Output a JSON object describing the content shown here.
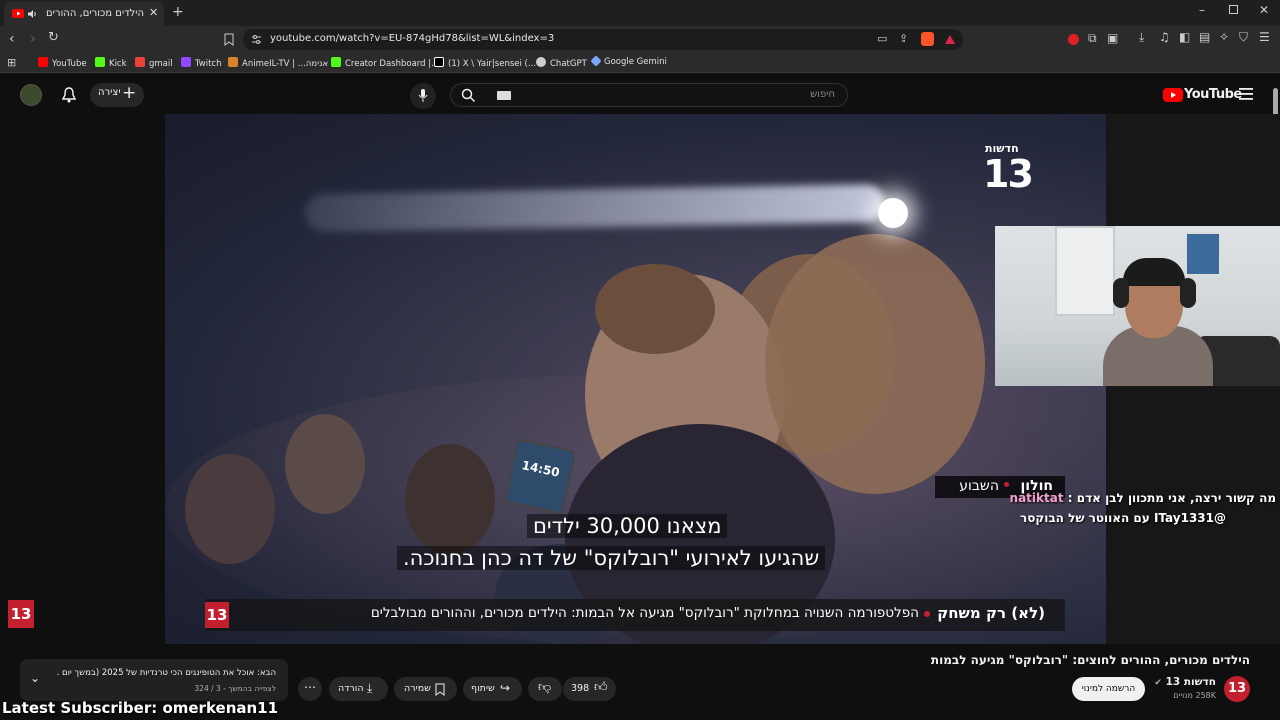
{
  "browser": {
    "tab_title": "הילדים מכורים, ההורים לחוצים",
    "url": "youtube.com/watch?v=EU-874gHd78&list=WL&index=3",
    "bookmarks": [
      {
        "label": "YouTube",
        "color": "#ff0000"
      },
      {
        "label": "Kick",
        "color": "#53fc18"
      },
      {
        "label": "gmail",
        "color": "#ea4335"
      },
      {
        "label": "Twitch",
        "color": "#9146ff"
      },
      {
        "label": "AnimeIL-TV | ...אנימה",
        "color": "#d9822b"
      },
      {
        "label": "Creator Dashboard |...",
        "color": "#53fc18"
      },
      {
        "label": "(1) X \\ Yair|sensei (...",
        "color": "#ffffff"
      },
      {
        "label": "ChatGPT",
        "color": "#cfcfcf"
      },
      {
        "label": "Google Gemini",
        "color": "#7aa6ff"
      }
    ]
  },
  "yt_header": {
    "logo": "YouTube",
    "search_placeholder": "חיפוש",
    "create_label": "יצירה"
  },
  "video": {
    "channel_logo_text": "13",
    "channel_logo_caption": "חדשות",
    "subtitle_line1": "מצאנו 30,000 ילדים",
    "subtitle_line2": "שהגיעו לאירועי \"רובלוקס\" של דה כהן בחנוכה.",
    "tag_bold": "חולון",
    "tag_rest": "השבוע",
    "lower_third_bold": "(לא) רק משחק",
    "lower_third_text": "הפלטפורמה השנויה במחלוקת \"רובלוקס\" מגיעה אל הבמות: הילדים מכורים, וההורים מבולבלים",
    "phone_time": "14:50"
  },
  "stream_overlay": {
    "chat_user": "natiktat",
    "chat_line1": "מה קשור ירצה, אני מתכוון לבן אדם :",
    "chat_line2": "@ITay1331 עם האווטר של הבוקסר",
    "latest_subscriber": "Latest Subscriber: omerkenan11"
  },
  "below_video": {
    "title": "הילדים מכורים, ההורים לחוצים: \"רובלוקס\" מגיעה לבמות",
    "channel_name": "חדשות 13",
    "subscribers": "258K מנויים",
    "subscribe_label": "הרשמה למינוי",
    "likes": "398",
    "share_label": "שיתוף",
    "save_label": "שמירה",
    "download_label": "הורדה"
  },
  "playlist": {
    "next_label": "הבא: אוכל את הטופינגים הכי טרנדיות של 2025 (במשך יום ...",
    "progress": "לצפייה בהמשך - 3 / 324"
  }
}
